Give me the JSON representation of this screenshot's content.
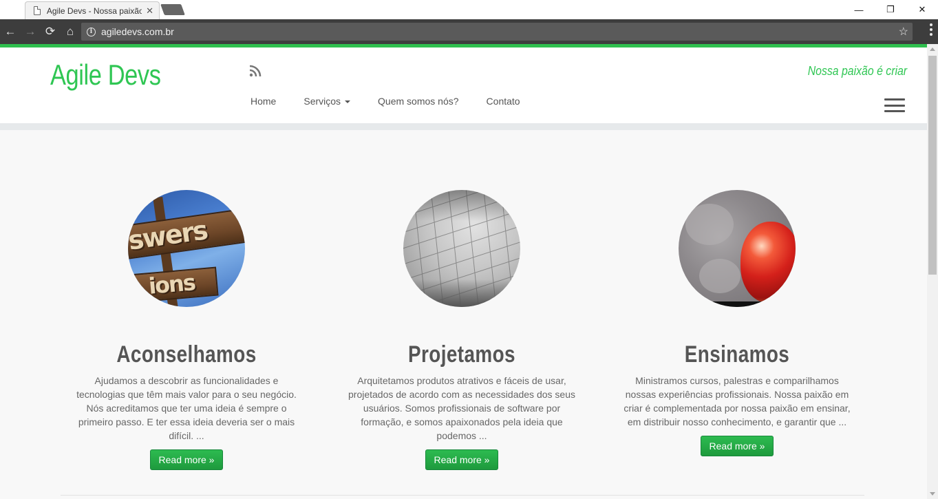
{
  "browser": {
    "tab_title": "Agile Devs - Nossa paixão é criar",
    "close_glyph": "✕",
    "url": "agiledevs.com.br",
    "window_controls": {
      "minimize": "—",
      "maximize": "❐",
      "close": "✕"
    },
    "nav": {
      "back": "←",
      "forward": "→",
      "reload": "⟳",
      "home": "⌂",
      "star": "☆"
    }
  },
  "site": {
    "brand": "Agile Devs",
    "tagline": "Nossa paixão é criar",
    "nav": [
      {
        "label": "Home"
      },
      {
        "label": "Serviços",
        "dropdown": true
      },
      {
        "label": "Quem somos nós?"
      },
      {
        "label": "Contato"
      }
    ]
  },
  "features": [
    {
      "title": "Aconselhamos",
      "text": "Ajudamos a descobrir as funcionalidades e tecnologias que têm mais valor para o seu negócio. Nós acreditamos que ter uma ideia é sempre o primeiro passo. E ter essa ideia deveria ser o mais difícil. ...",
      "button": "Read more »",
      "image_text": {
        "line1": "swers",
        "line2": "ions"
      }
    },
    {
      "title": "Projetamos",
      "text": "Arquitetamos produtos atrativos e fáceis de usar, projetados de acordo com as necessidades dos seus usuários. Somos profissionais de software por formação, e somos apaixonados pela ideia que podemos ...",
      "button": "Read more »"
    },
    {
      "title": "Ensinamos",
      "text": "Ministramos cursos, palestras e comparilhamos nossas experiências profissionais. Nossa paixão em criar é complementada por nossa paixão em ensinar, em distribuir nosso conhecimento, e garantir que ...",
      "button": "Read more »"
    }
  ],
  "colors": {
    "brand_green": "#2fc653",
    "button_green": "#22a846",
    "chrome_dark": "#3d3d3d"
  },
  "icons": [
    "page-icon",
    "info-icon",
    "rss-icon",
    "hamburger-menu-icon",
    "star-icon"
  ]
}
